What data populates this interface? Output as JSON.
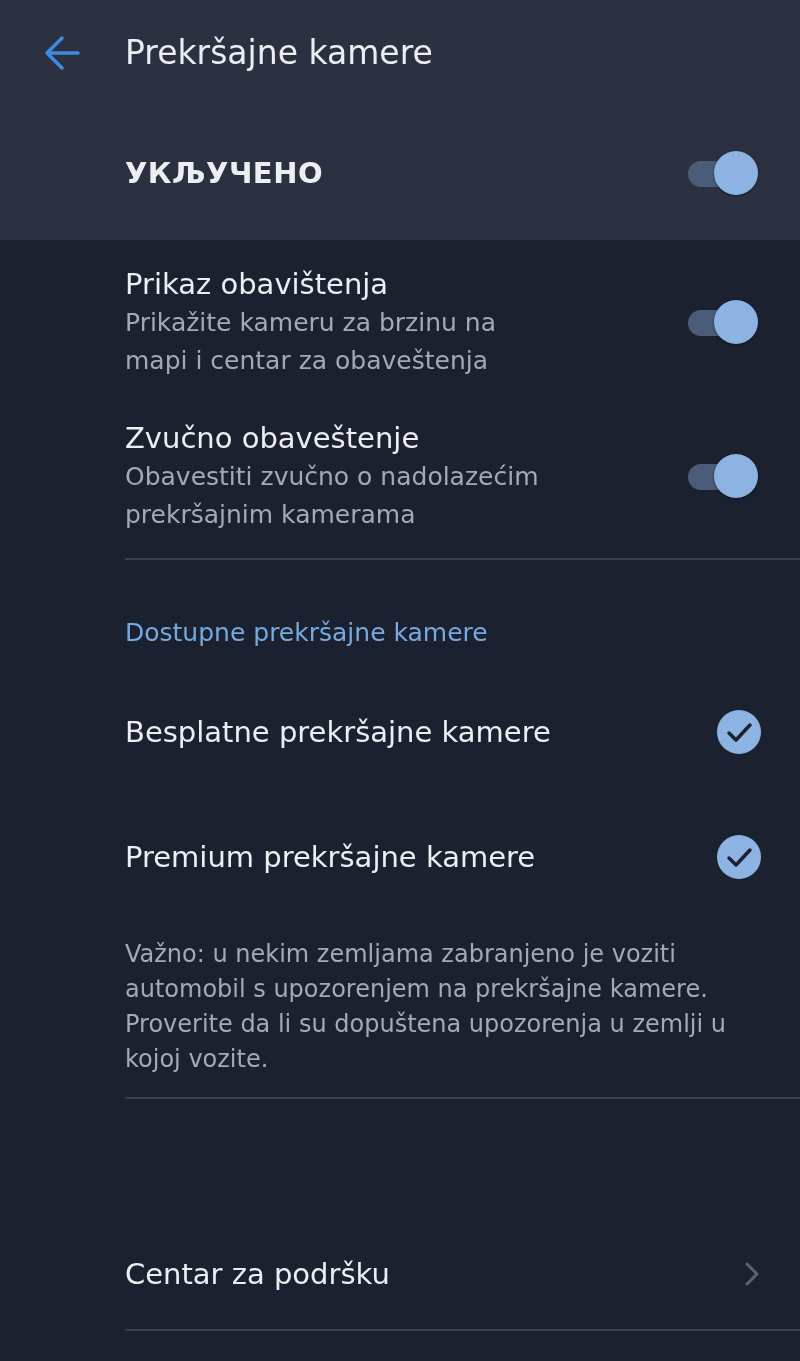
{
  "app_bar": {
    "title": "Prekršajne kamere"
  },
  "master": {
    "label": "УКЉУЧЕНО",
    "on": true
  },
  "settings": [
    {
      "title": "Prikaz obavištenja",
      "subtitle": "Prikažite kameru za brzinu na mapi i centar za obaveštenja",
      "on": true
    },
    {
      "title": "Zvučno obaveštenje",
      "subtitle": "Obavestiti zvučno o nadolazećim prekršajnim kamerama",
      "on": true
    }
  ],
  "section": {
    "title": "Dostupne prekršajne kamere",
    "options": [
      {
        "label": "Besplatne prekršajne kamere",
        "checked": true
      },
      {
        "label": "Premium prekršajne kamere",
        "checked": true
      }
    ]
  },
  "note": "Važno: u nekim zemljama zabranjeno je voziti automobil s upozorenjem na prekršajne kamere. Proverite da li su dopuštena upozorenja u zemlji u kojoj vozite.",
  "support": {
    "label": "Centar za podršku"
  }
}
